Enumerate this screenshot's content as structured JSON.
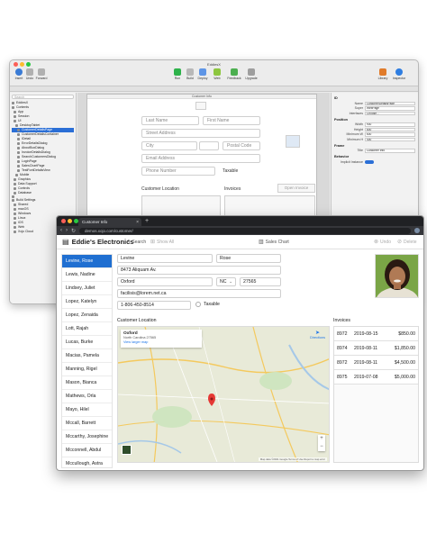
{
  "ide": {
    "title": "EddiesX",
    "toolbar_left": [
      "Insert",
      "Undo",
      "Forward"
    ],
    "toolbar_center": [
      "Run",
      "Build",
      "Deploy",
      "Web",
      "Feedback",
      "Upgrade"
    ],
    "toolbar_right": [
      "Library",
      "Inspector"
    ],
    "nav_search": "Search",
    "nav_items": [
      {
        "label": "EddiesX",
        "selected": false
      },
      {
        "label": "Contents",
        "selected": false
      },
      {
        "label": "App",
        "selected": false
      },
      {
        "label": "Session",
        "selected": false
      },
      {
        "label": "UI",
        "selected": false
      },
      {
        "label": "DesktopTablet",
        "selected": false
      },
      {
        "label": "CustomerDetailsPage",
        "selected": true
      },
      {
        "label": "CustomerDetailsContainer",
        "selected": false
      },
      {
        "label": "IDetail",
        "selected": false
      },
      {
        "label": "ErrorDetailsDialog",
        "selected": false
      },
      {
        "label": "AboutBoxDialog",
        "selected": false
      },
      {
        "label": "InvoiceDetailsDialog",
        "selected": false
      },
      {
        "label": "SearchCustomersDialog",
        "selected": false
      },
      {
        "label": "LoginPage",
        "selected": false
      },
      {
        "label": "SalesChartPage",
        "selected": false
      },
      {
        "label": "TestFontDetailsView",
        "selected": false
      },
      {
        "label": "Mobile",
        "selected": false
      },
      {
        "label": "Graphics",
        "selected": false
      },
      {
        "label": "Data Support",
        "selected": false
      },
      {
        "label": "Controls",
        "selected": false
      },
      {
        "label": "Database",
        "selected": false
      },
      {
        "label": "",
        "selected": false
      },
      {
        "label": "Build Settings",
        "selected": false
      },
      {
        "label": "Shared",
        "selected": false
      },
      {
        "label": "macOS",
        "selected": false
      },
      {
        "label": "Windows",
        "selected": false
      },
      {
        "label": "Linux",
        "selected": false
      },
      {
        "label": "iOS",
        "selected": false
      },
      {
        "label": "Web",
        "selected": false
      },
      {
        "label": "Xojo Cloud",
        "selected": false
      }
    ],
    "layout_title": "Customer Info",
    "layout_fields": {
      "last_name": "Last Name",
      "first_name": "First Name",
      "street": "Street Address",
      "city": "City",
      "postal": "Postal Code",
      "email": "Email Address",
      "phone": "Phone Number",
      "taxable": "Taxable",
      "customer_location": "Customer Location",
      "invoices": "Invoices",
      "open_invoice": "Open Invoice"
    },
    "inspector": {
      "section_id": "ID",
      "rows_id": [
        {
          "k": "Name",
          "v": "CustomerDetailsPage"
        },
        {
          "k": "Super",
          "v": "WebPage"
        },
        {
          "k": "Interfaces",
          "v": "Choose..."
        }
      ],
      "section_position": "Position",
      "rows_position": [
        {
          "k": "Width",
          "v": "900"
        },
        {
          "k": "Height",
          "v": "800"
        },
        {
          "k": "Minimum W",
          "v": "600"
        },
        {
          "k": "Minimum H",
          "v": "400"
        }
      ],
      "section_frame": "Frame",
      "rows_frame": [
        {
          "k": "Title",
          "v": "Customer Info"
        }
      ],
      "section_behavior": "Behavior",
      "rows_behavior": [
        {
          "k": "Implicit Instance",
          "v": ""
        }
      ]
    }
  },
  "browser": {
    "tab_title": "Customer Info",
    "tab_close": "×",
    "new_tab": "+",
    "url": "demos.xojo.com/customer/",
    "back": "‹",
    "forward": "›",
    "reload": "↻"
  },
  "app": {
    "logo": "▤",
    "title": "Eddie's Electronics",
    "search": "Search",
    "show_all": "Show All",
    "sales_chart": "Sales Chart",
    "undo": "Undo",
    "delete": "Delete",
    "customers": [
      "Levine, Rose",
      "Lewis, Nadine",
      "Lindsey, Juliet",
      "Lopez, Katelyn",
      "Lopez, Zenaida",
      "Lott, Rajah",
      "Lucas, Burke",
      "Macias, Pamela",
      "Manning, Rigel",
      "Mason, Bianca",
      "Mathews, Orla",
      "Mayo, Hilel",
      "Mccall, Barrett",
      "Mccarthy, Josephine",
      "Mcconnell, Abdul",
      "Mccullough, Astra",
      "Mcintyre, Martina"
    ],
    "selected_customer_index": 0,
    "detail": {
      "last_name": "Levine",
      "first_name": "Rose",
      "street": "8473 Aliquam Av.",
      "city": "Oxford",
      "state": "NC",
      "zip": "27565",
      "email": "facilisis@lorem.net.ca",
      "phone": "1-806-450-8514",
      "taxable": "Taxable",
      "customer_location": "Customer Location",
      "invoices_label": "Invoices"
    },
    "map": {
      "city": "Oxford",
      "address": "North Carolina 27565",
      "larger_map": "View larger map",
      "directions": "Directions",
      "zoom_in": "+",
      "zoom_out": "−",
      "footer": "Map data ©2021 Google   Terms of Use   Report a map error"
    },
    "invoices": [
      {
        "id": "8972",
        "date": "2019-08-15",
        "amount": "$850.00"
      },
      {
        "id": "8974",
        "date": "2019-08-11",
        "amount": "$1,850.00"
      },
      {
        "id": "8972",
        "date": "2019-08-11",
        "amount": "$4,500.00"
      },
      {
        "id": "8975",
        "date": "2019-07-08",
        "amount": "$5,000.00"
      }
    ]
  },
  "colors": {
    "accent": "#1f6fd1",
    "traffic_red": "#fc5f57",
    "traffic_yellow": "#fdbc2e",
    "traffic_green": "#28c840"
  }
}
